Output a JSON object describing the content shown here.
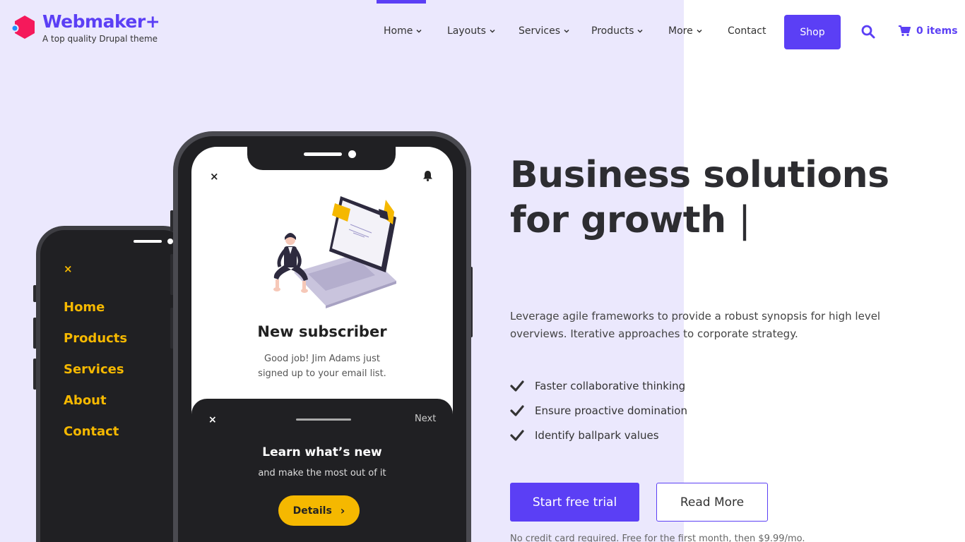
{
  "brand": {
    "name": "Webmaker+",
    "tagline": "A top quality Drupal theme",
    "accent": "#5b3ff5",
    "logo_color": "#f5195b"
  },
  "nav": {
    "items": [
      {
        "label": "Home",
        "has_dropdown": true,
        "active": true
      },
      {
        "label": "Layouts",
        "has_dropdown": true
      },
      {
        "label": "Services",
        "has_dropdown": true
      },
      {
        "label": "Products",
        "has_dropdown": true
      },
      {
        "label": "More",
        "has_dropdown": true
      },
      {
        "label": "Contact",
        "has_dropdown": false
      }
    ],
    "shop_label": "Shop",
    "cart_label": "0 items",
    "search_icon": "search-icon",
    "cart_icon": "cart-icon"
  },
  "hero": {
    "headline_line1": "Business solutions",
    "headline_line2": "for growth",
    "cursor": "|",
    "lead": "Leverage agile frameworks to provide a robust synopsis for high level overviews. Iterative approaches to corporate strategy.",
    "checklist": [
      "Faster collaborative thinking",
      "Ensure proactive domination",
      "Identify ballpark values"
    ],
    "primary_cta": "Start free trial",
    "secondary_cta": "Read More",
    "fineprint": "No credit card required. Free for the first month, then $9.99/mo."
  },
  "phone_back": {
    "close": "×",
    "menu": [
      "Home",
      "Products",
      "Services",
      "About",
      "Contact"
    ],
    "menu_color": "#f5b800"
  },
  "phone_front": {
    "close": "×",
    "title": "New subscriber",
    "body": "Good job! Jim Adams just signed up to your email list.",
    "sheet": {
      "close": "×",
      "next": "Next",
      "title": "Learn what’s new",
      "subtitle": "and make the most out of it",
      "button": "Details",
      "button_arrow": "›"
    }
  }
}
